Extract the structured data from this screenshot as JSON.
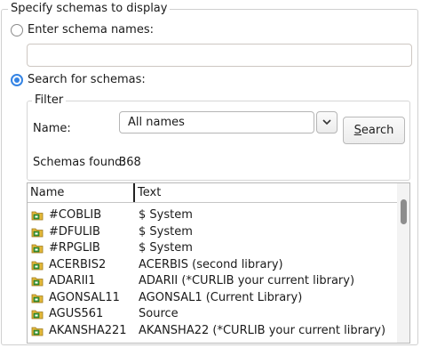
{
  "group": {
    "title": "Specify schemas to display"
  },
  "option_enter": {
    "label": "Enter schema names:",
    "selected": false,
    "value": ""
  },
  "option_search": {
    "label": "Search for schemas:",
    "selected": true
  },
  "filter": {
    "title": "Filter",
    "name_label": "Name:",
    "name_value": "All names",
    "search_button": "Search",
    "search_mnemonic": "S",
    "found_label": "Schemas found:",
    "found_count": "368"
  },
  "table": {
    "columns": [
      "Name",
      "Text"
    ],
    "rows": [
      {
        "name": "#COBLIB",
        "text": "$ System"
      },
      {
        "name": "#DFULIB",
        "text": "$ System"
      },
      {
        "name": "#RPGLIB",
        "text": "$ System"
      },
      {
        "name": "ACERBIS2",
        "text": "ACERBIS (second library)"
      },
      {
        "name": "ADARII1",
        "text": "ADARII (*CURLIB your current library)"
      },
      {
        "name": "AGONSAL11",
        "text": "AGONSAL1 (Current Library)"
      },
      {
        "name": "AGUS561",
        "text": "Source"
      },
      {
        "name": "AKANSHA221",
        "text": "AKANSHA22 (*CURLIB your current library)"
      }
    ]
  },
  "icons": {
    "library": "library-folder-icon",
    "dropdown": "chevron-down-icon"
  },
  "colors": {
    "accent": "#3584e4",
    "icon_folder": "#e5b93a",
    "icon_badge": "#3a9a3a"
  }
}
